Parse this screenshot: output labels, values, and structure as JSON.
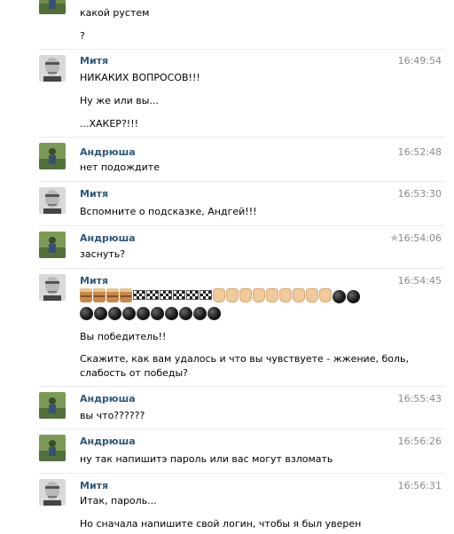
{
  "partial_top": {
    "line1": "какой рустем",
    "line2": "?"
  },
  "messages": [
    {
      "author": "Митя",
      "time": "16:49:54",
      "lines": [
        "НИКАКИХ ВОПРОСОВ!!!",
        "Ну же или вы...",
        "...ХАКЕР?!!!"
      ]
    },
    {
      "author": "Андрюша",
      "time": "16:52:48",
      "lines": [
        "нет подождите"
      ]
    },
    {
      "author": "Митя",
      "time": "16:53:30",
      "lines": [
        "Вспомните о подсказке, Андгей!!!"
      ]
    },
    {
      "author": "Андрюша",
      "time": "16:54:06",
      "lines": [
        "заснуть?"
      ]
    },
    {
      "author": "Митя",
      "time": "16:54:45",
      "lines": [
        "Вы победитель!!",
        "Скажите, как вам удалось и что вы чувствуете - жжение, боль,",
        "слабость от победы?"
      ]
    },
    {
      "author": "Андрюша",
      "time": "16:55:43",
      "lines": [
        "вы что??????"
      ]
    },
    {
      "author": "Андрюша",
      "time": "16:56:26",
      "lines": [
        "ну так напишитэ пароль или вас могут взломать"
      ]
    },
    {
      "author": "Митя",
      "time": "16:56:31",
      "lines": [
        "Итак, пароль...",
        "Но сначала напишите свой логин, чтобы я был уверен"
      ]
    }
  ],
  "emoji": {
    "row1": [
      "cake",
      "cake",
      "cake",
      "cake",
      "flag",
      "flag",
      "flag",
      "flag",
      "flag",
      "flag",
      "hand",
      "hand",
      "hand",
      "hand",
      "hand",
      "hand",
      "hand",
      "hand",
      "hand",
      "bomb",
      "bomb"
    ],
    "row2": [
      "bomb",
      "bomb",
      "bomb",
      "bomb",
      "bomb",
      "bomb",
      "bomb",
      "bomb",
      "bomb",
      "bomb"
    ]
  },
  "icons": {
    "star": "star-icon"
  },
  "colors": {
    "author": "#2b587a",
    "time": "#8a8a8a",
    "separator": "#e6ebf0"
  }
}
